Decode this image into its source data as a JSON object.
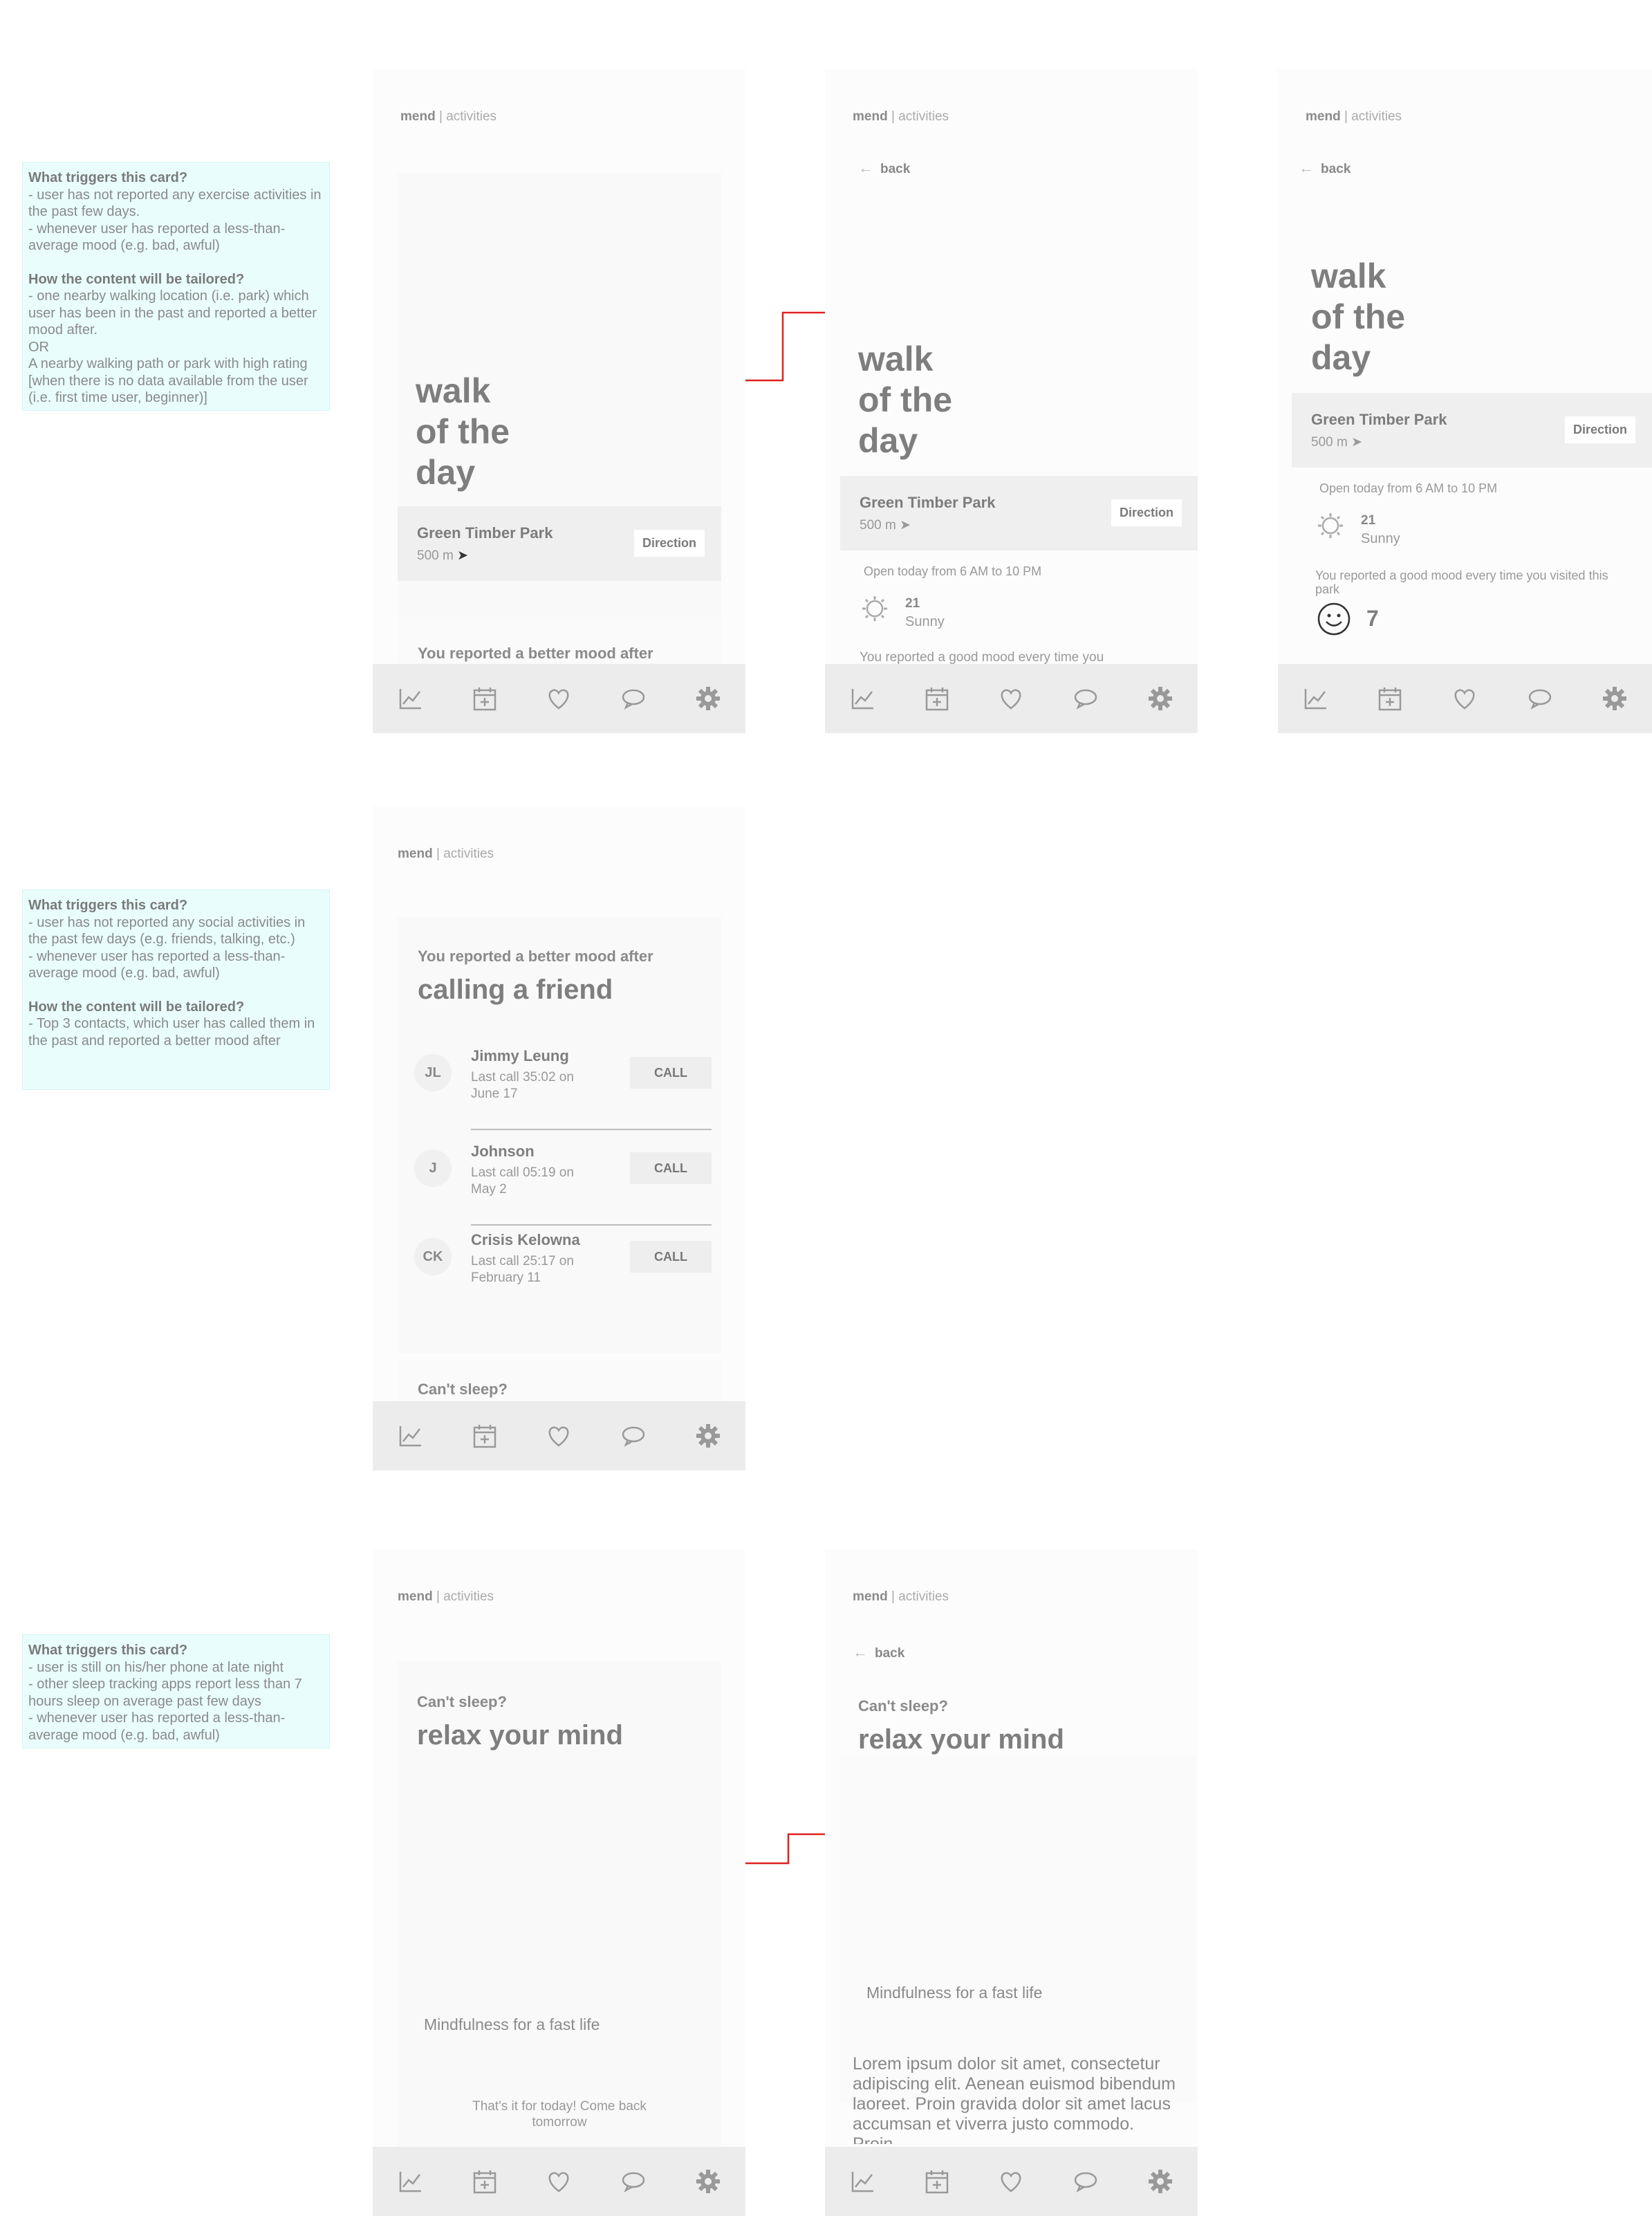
{
  "colors": {
    "accent_arrow": "#e02020",
    "note_bg": "#e9fdfd",
    "card_bar": "#efefef"
  },
  "brand": {
    "name": "mend",
    "sep": " | ",
    "section": "activities"
  },
  "back_label": "back",
  "notes": {
    "walk": {
      "trigger_heading": "What triggers this card?",
      "trigger_lines": [
        "- user has not reported any exercise activities in the past few days.",
        "- whenever user has reported a less-than-average mood (e.g. bad, awful)"
      ],
      "tailor_heading": "How the content will be tailored?",
      "tailor_lines": [
        "- one nearby walking location (i.e. park) which user has been in the past and reported a better mood after.",
        "OR",
        "A nearby walking path or park with high rating [when there is no data available from the user (i.e. first time user, beginner)]"
      ]
    },
    "social": {
      "trigger_heading": "What triggers this card?",
      "trigger_lines": [
        "- user has not reported any social activities in the past few days (e.g. friends, talking, etc.)",
        "- whenever user has reported a less-than-average mood (e.g. bad, awful)"
      ],
      "tailor_heading": "How the content will be tailored?",
      "tailor_lines": [
        "- Top 3 contacts, which user has called them in the past and reported a better mood after"
      ]
    },
    "sleep": {
      "trigger_heading": "What triggers this card?",
      "trigger_lines": [
        "- user is still on his/her phone at late night",
        "- other sleep tracking apps report less than 7 hours sleep on average past few days",
        "- whenever user has reported a less-than-average mood (e.g. bad, awful)"
      ]
    }
  },
  "walk": {
    "title_lines": [
      "walk",
      "of the",
      "day"
    ],
    "park_name": "Green Timber Park",
    "distance": "500 m",
    "direction_label": "Direction",
    "next_card_teaser": "You reported a better mood after",
    "hours": "Open today from 6 AM to 10 PM",
    "temperature": "21",
    "condition": "Sunny",
    "mood_text": "You reported a good mood every time you visited this park",
    "mood_text_cut": "You reported a good mood every time you",
    "mood_count": "7"
  },
  "social": {
    "subtitle": "You reported a better mood after",
    "title": "calling a friend",
    "call_label": "CALL",
    "contacts": [
      {
        "initials": "JL",
        "name": "Jimmy Leung",
        "last_call": "Last call 35:02 on June 17"
      },
      {
        "initials": "J",
        "name": "Johnson",
        "last_call": "Last call 05:19 on May 2"
      },
      {
        "initials": "CK",
        "name": "Crisis Kelowna",
        "last_call": "Last call 25:17 on February 11"
      }
    ],
    "next_card_teaser": "Can't sleep?"
  },
  "sleep": {
    "subtitle": "Can't sleep?",
    "title": "relax your mind",
    "media_caption": "Mindfulness for a fast life",
    "end_message": "That's it for today! Come back tomorrow",
    "lorem": "Lorem ipsum dolor sit amet, consectetur adipiscing elit. Aenean euismod bibendum laoreet. Proin gravida dolor sit amet lacus accumsan et viverra justo commodo. Proin"
  },
  "nav": [
    "trends-icon",
    "calendar-add-icon",
    "heart-icon",
    "chat-icon",
    "settings-gear-icon"
  ]
}
